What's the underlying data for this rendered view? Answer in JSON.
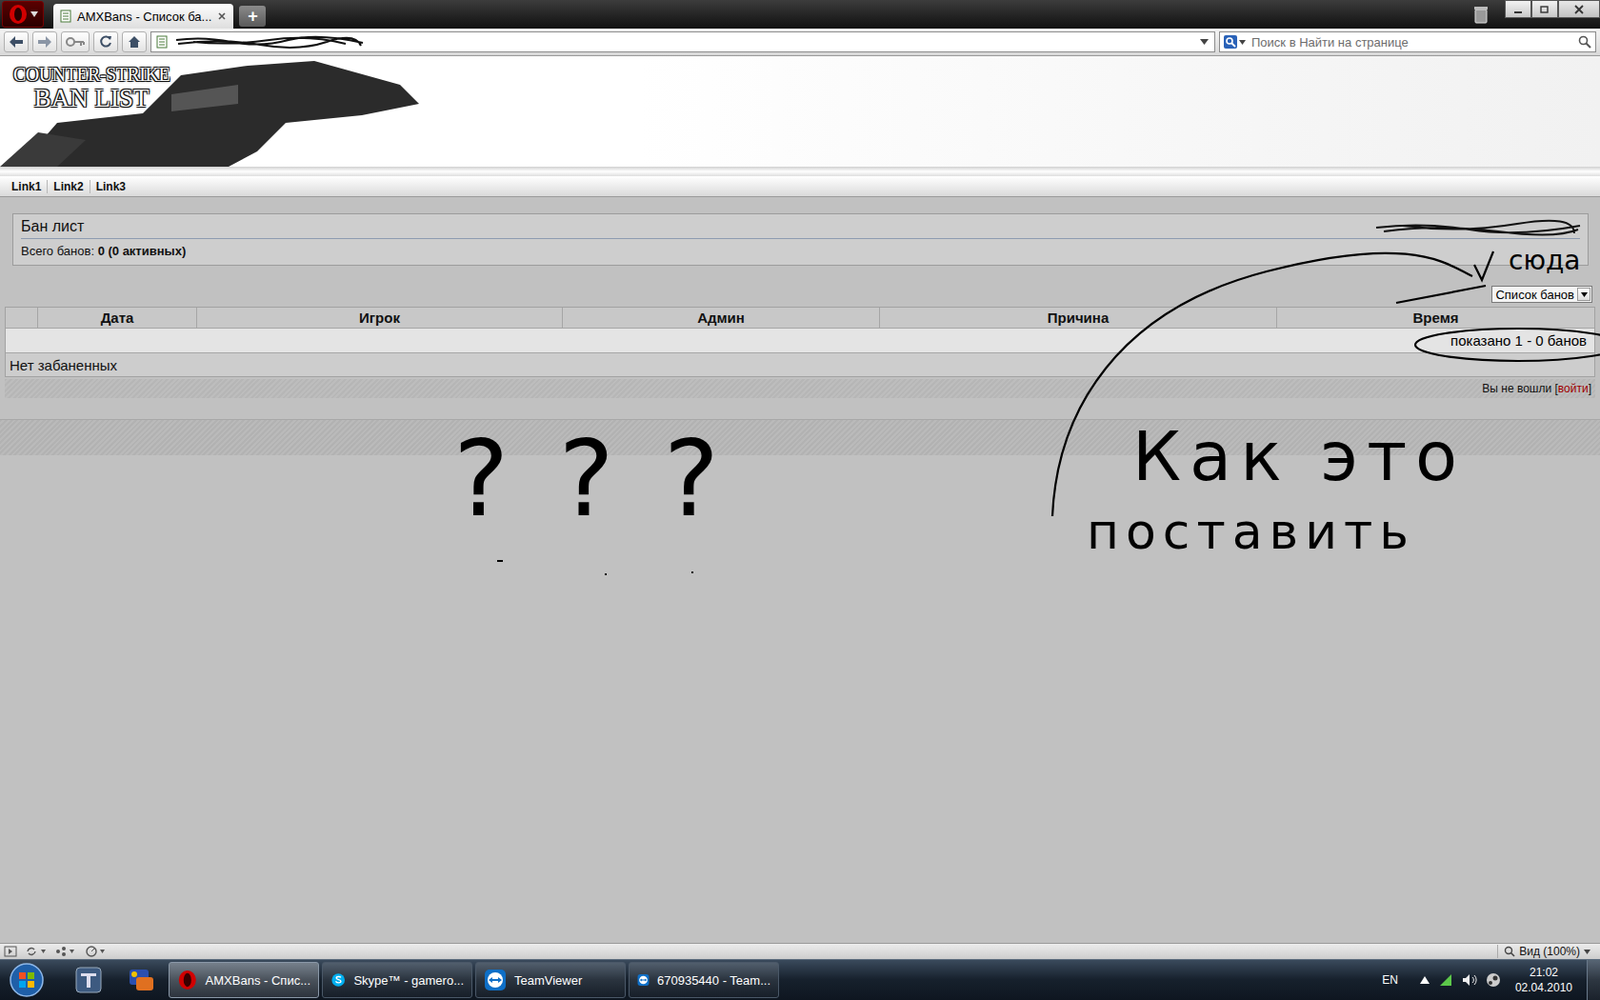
{
  "browser": {
    "tabs": [
      {
        "label": "AMXBans - Список ба...",
        "selected": true
      }
    ],
    "new_tab": "+",
    "search": {
      "placeholder": "Поиск в Найти на странице"
    },
    "status_bar": {
      "zoom": "Вид (100%)"
    }
  },
  "page": {
    "logo": {
      "line1": "COUNTER-STRIKE",
      "line2": "BAN LIST"
    },
    "nav": [
      "Link1",
      "Link2",
      "Link3"
    ],
    "panel": {
      "title": "Бан лист",
      "total_label": "Всего банов:",
      "total_value": "0 (0 активных)"
    },
    "view_select": "Список банов",
    "table": {
      "columns": [
        "",
        "Дата",
        "Игрок",
        "Админ",
        "Причина",
        "Время"
      ],
      "pager": "показано 1 - 0 банов",
      "rows": [],
      "empty": "Нет забаненных"
    },
    "login": {
      "prefix": "Вы не вошли [",
      "link": "войти",
      "suffix": "]"
    }
  },
  "annotations": {
    "questions": "???",
    "arrow_target": "сюда",
    "question_line1": "Как это",
    "question_line2": "поставить"
  },
  "taskbar": {
    "pinned": [
      {
        "kind": "teamspeak"
      },
      {
        "kind": "mirc"
      }
    ],
    "items": [
      {
        "kind": "opera",
        "label": "AMXBans - Спис...",
        "selected": true
      },
      {
        "kind": "skype",
        "label": "Skype™ - gamero...",
        "selected": false
      },
      {
        "kind": "teamviewer",
        "label": "TeamViewer",
        "selected": false
      },
      {
        "kind": "teamviewer",
        "label": "670935440 - Team...",
        "selected": false
      }
    ],
    "language": "EN",
    "time": "21:02",
    "date": "02.04.2010"
  }
}
